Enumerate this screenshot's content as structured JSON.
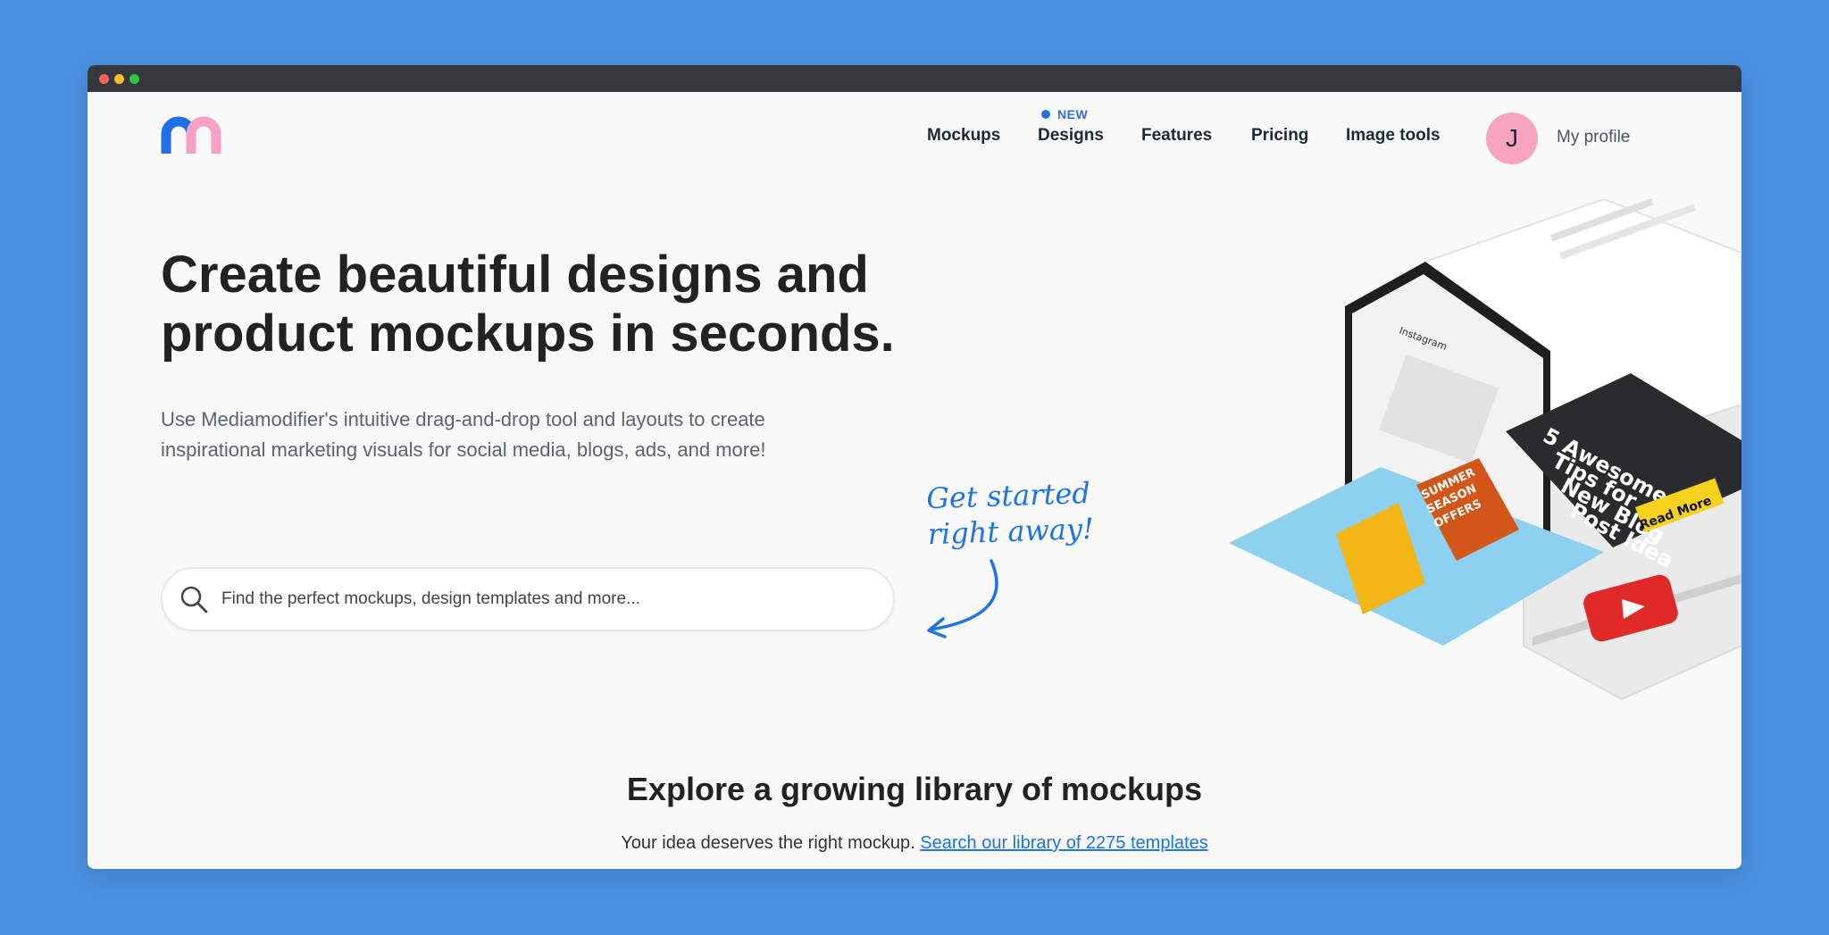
{
  "nav": {
    "new_badge": "NEW",
    "items": [
      "Mockups",
      "Designs",
      "Features",
      "Pricing",
      "Image tools"
    ],
    "avatar_initial": "J",
    "profile_label": "My profile"
  },
  "hero": {
    "title_line1": "Create beautiful designs and",
    "title_line2": "product mockups in seconds.",
    "subtitle_line1": "Use Mediamodifier's intuitive drag-and-drop tool and layouts to create",
    "subtitle_line2": "inspirational marketing visuals for social media, blogs, ads, and more!",
    "handwritten_line1": "Get started",
    "handwritten_line2": "right away!"
  },
  "search": {
    "placeholder": "Find the perfect mockups, design templates and more..."
  },
  "illustration": {
    "app_name": "Instagram",
    "summer_card": [
      "SUMMER",
      "SEASON",
      "OFFERS"
    ],
    "blog_card": [
      "5 Awesome",
      "Tips for",
      "New Blog",
      "Post Idea"
    ],
    "read_more": "Read More"
  },
  "explore": {
    "title": "Explore a growing library of mockups",
    "subtitle": "Your idea deserves the right mockup.",
    "link": "Search our library of 2275 templates"
  },
  "colors": {
    "background": "#4a90e2",
    "accent": "#1e73e8",
    "logo_blue": "#1e6fe8",
    "logo_pink": "#f7a1c4",
    "avatar": "#f8a4c0"
  }
}
